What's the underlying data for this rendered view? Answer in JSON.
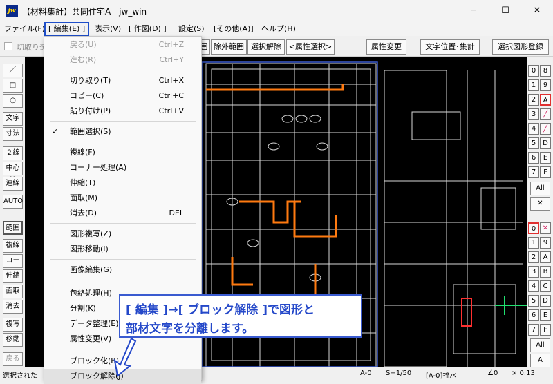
{
  "window": {
    "title": "【材料集計】共同住宅A - jw_win",
    "icon": "jw",
    "minimize": "─",
    "maximize": "☐",
    "close": "✕"
  },
  "menubar": {
    "items": [
      "ファイル(F)",
      "[ 編集(E) ]",
      "表示(V)",
      "[ 作図(D) ]",
      "設定(S)",
      "[その他(A)]",
      "ヘルプ(H)"
    ]
  },
  "toolbar": {
    "cut_range": "切取り選",
    "buttons": [
      "囲",
      "除外範囲",
      "選択解除",
      "<属性選択>",
      "属性変更",
      "文字位置･集計",
      "選択図形登録"
    ]
  },
  "left_tools": [
    "／",
    "□",
    "○",
    "文字",
    "寸法",
    "２線",
    "中心線",
    "連線",
    "AUTO",
    "範囲",
    "複線",
    "コーナー",
    "伸縮",
    "面取",
    "消去",
    "複写",
    "移動",
    "戻る"
  ],
  "right_tools": {
    "layers": [
      [
        "0",
        "8"
      ],
      [
        "1",
        "9"
      ],
      [
        "2",
        "A"
      ],
      [
        "3",
        ""
      ],
      [
        "4",
        ""
      ],
      [
        "5",
        "D"
      ],
      [
        "6",
        "E"
      ],
      [
        "7",
        "F"
      ]
    ],
    "all": "All",
    "groups": [
      "0",
      "1",
      "2",
      "3",
      "4",
      "5",
      "6",
      "7"
    ],
    "group_right": [
      "",
      "9",
      "A",
      "B",
      "C",
      "D",
      "E",
      "F"
    ],
    "all2": "All",
    "a": "A"
  },
  "edit_menu": {
    "items": [
      {
        "label": "戻る(U)",
        "shortcut": "Ctrl+Z",
        "disabled": true
      },
      {
        "label": "進む(R)",
        "shortcut": "Ctrl+Y",
        "disabled": true
      },
      {
        "label": "切り取り(T)",
        "shortcut": "Ctrl+X"
      },
      {
        "label": "コピー(C)",
        "shortcut": "Ctrl+C"
      },
      {
        "label": "貼り付け(P)",
        "shortcut": "Ctrl+V"
      },
      {
        "label": "範囲選択(S)",
        "shortcut": "",
        "checked": true
      },
      {
        "label": "複線(F)",
        "shortcut": ""
      },
      {
        "label": "コーナー処理(A)",
        "shortcut": ""
      },
      {
        "label": "伸縮(T)",
        "shortcut": ""
      },
      {
        "label": "面取(M)",
        "shortcut": ""
      },
      {
        "label": "消去(D)",
        "shortcut": "DEL"
      },
      {
        "label": "図形複写(Z)",
        "shortcut": ""
      },
      {
        "label": "図形移動(I)",
        "shortcut": ""
      },
      {
        "label": "画像編集(G)",
        "shortcut": ""
      },
      {
        "label": "包絡処理(H)",
        "shortcut": ""
      },
      {
        "label": "分割(K)",
        "shortcut": ""
      },
      {
        "label": "データ整理(E)",
        "shortcut": ""
      },
      {
        "label": "属性変更(V)",
        "shortcut": ""
      },
      {
        "label": "ブロック化(B)",
        "shortcut": ""
      },
      {
        "label": "ブロック解除(J)",
        "shortcut": ""
      }
    ],
    "checkmark": "✓"
  },
  "callout": {
    "line1": "[ 編集 ]→[ ブロック解除 ]で図形と",
    "line2": "部材文字を分離します。"
  },
  "statusbar": {
    "left": "選択された",
    "layer": "A-0",
    "scale": "S=1/50",
    "layer_name": "[A-0]排水",
    "angle": "∠0",
    "zoom": "× 0.13"
  },
  "colors": {
    "accent": "#1e4ec9",
    "orange": "#ff7a10",
    "canvas": "#000000",
    "lines": "#dcdcdc"
  }
}
